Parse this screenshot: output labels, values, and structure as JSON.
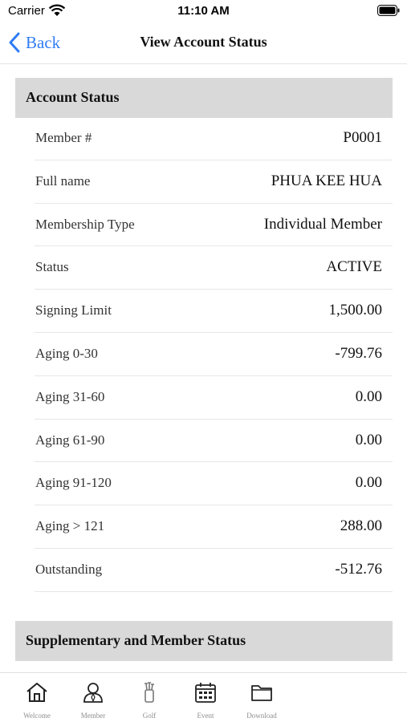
{
  "status_bar": {
    "carrier": "Carrier",
    "time": "11:10 AM"
  },
  "nav": {
    "back_label": "Back",
    "title": "View Account Status"
  },
  "account_section": {
    "title": "Account Status",
    "rows": [
      {
        "label": "Member #",
        "value": "P0001"
      },
      {
        "label": "Full name",
        "value": "PHUA KEE HUA"
      },
      {
        "label": "Membership Type",
        "value": "Individual Member"
      },
      {
        "label": "Status",
        "value": "ACTIVE"
      },
      {
        "label": "Signing Limit",
        "value": "1,500.00"
      },
      {
        "label": "Aging 0-30",
        "value": "-799.76"
      },
      {
        "label": "Aging 31-60",
        "value": "0.00"
      },
      {
        "label": "Aging 61-90",
        "value": "0.00"
      },
      {
        "label": "Aging 91-120",
        "value": "0.00"
      },
      {
        "label": "Aging > 121",
        "value": "288.00"
      },
      {
        "label": "Outstanding",
        "value": "-512.76"
      }
    ]
  },
  "supplementary_section": {
    "title": "Supplementary and Member Status"
  },
  "tab_bar": {
    "tabs": [
      {
        "label": "Welcome",
        "icon": "home-icon"
      },
      {
        "label": "Member",
        "icon": "member-icon"
      },
      {
        "label": "Golf",
        "icon": "golf-icon"
      },
      {
        "label": "Event",
        "icon": "calendar-icon"
      },
      {
        "label": "Download",
        "icon": "folder-icon"
      }
    ]
  },
  "colors": {
    "accent": "#2f7cf6",
    "section_header_bg": "#d9d9d9",
    "tab_label": "#8e8e8e"
  }
}
